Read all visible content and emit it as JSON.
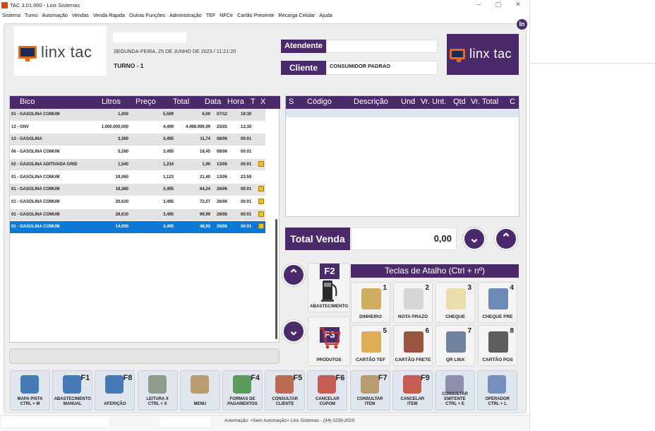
{
  "window": {
    "title": "TAC 3.01.000 - Linx Sistemas",
    "min": "─",
    "max": "▢",
    "close": "✕"
  },
  "menu": [
    "Sistema",
    "Turno",
    "Automação",
    "Vendas",
    "Venda Rapida",
    "Outras Funções",
    "Administração",
    "TEF",
    "NFCe",
    "Cartão Presente",
    "Recarga Celular",
    "Ajuda"
  ],
  "brand": {
    "logo_text": "linx tac",
    "badge": "In"
  },
  "header": {
    "datetime": "SEGUNDA-FEIRA, 25 DE JUNHO DE 2023 / 11:21:20",
    "turno": "TURNO - 1",
    "atendente_label": "Atendente",
    "atendente_value": "",
    "cliente_label": "Cliente",
    "cliente_value": "CONSUMIDOR PADRAO"
  },
  "abastecimentos": {
    "columns": [
      "Bico",
      "Litros",
      "Preço",
      "Total",
      "Data",
      "Hora",
      "T",
      "X"
    ],
    "rows": [
      {
        "bico": "01 - GASOLINA COMUM",
        "litros": "1,000",
        "preco": "5,599",
        "total": "6,00",
        "data": "07/12",
        "hora": "19:30",
        "t": false
      },
      {
        "bico": "13 - GNV",
        "litros": "1.000.000,000",
        "preco": "4,499",
        "total": "4.498.999,99",
        "data": "25/02",
        "hora": "13:35",
        "t": false
      },
      {
        "bico": "13 - GASOLINA",
        "litros": "3,360",
        "preco": "3,495",
        "total": "11,74",
        "data": "08/06",
        "hora": "00:01",
        "t": false
      },
      {
        "bico": "06 - GASOLINA COMUM",
        "litros": "5,280",
        "preco": "3,495",
        "total": "18,45",
        "data": "08/06",
        "hora": "00:01",
        "t": false
      },
      {
        "bico": "02 - GASOLINA ADITIVADA GRID",
        "litros": "1,540",
        "preco": "1,234",
        "total": "1,90",
        "data": "13/06",
        "hora": "00:01",
        "t": true
      },
      {
        "bico": "01 - GASOLINA COMUM",
        "litros": "19,060",
        "preco": "1,123",
        "total": "21,40",
        "data": "13/06",
        "hora": "23:59",
        "t": false
      },
      {
        "bico": "01 - GASOLINA COMUM",
        "litros": "18,380",
        "preco": "3,495",
        "total": "64,24",
        "data": "26/06",
        "hora": "00:01",
        "t": true
      },
      {
        "bico": "01 - GASOLINA COMUM",
        "litros": "20,620",
        "preco": "3,495",
        "total": "72,07",
        "data": "26/06",
        "hora": "00:01",
        "t": true
      },
      {
        "bico": "01 - GASOLINA COMUM",
        "litros": "28,610",
        "preco": "3,495",
        "total": "99,99",
        "data": "26/06",
        "hora": "00:01",
        "t": true
      },
      {
        "bico": "01 - GASOLINA COMUM",
        "litros": "14,000",
        "preco": "3,495",
        "total": "48,93",
        "data": "26/06",
        "hora": "00:01",
        "t": true
      }
    ]
  },
  "itens": {
    "columns": [
      "S",
      "Código",
      "Descrição",
      "Und",
      "Vr. Unt.",
      "Qtd",
      "Vr. Total",
      "C"
    ]
  },
  "total": {
    "label": "Total Venda",
    "value": "0,00"
  },
  "atalhos": {
    "title": "Teclas de Atalho (Ctrl + nº)",
    "keys": [
      {
        "num": "1",
        "label": "DINHEIRO"
      },
      {
        "num": "2",
        "label": "NOTA PRAZO"
      },
      {
        "num": "3",
        "label": "CHEQUE"
      },
      {
        "num": "4",
        "label": "CHEQUE PRE"
      },
      {
        "num": "5",
        "label": "CARTÃO TEF"
      },
      {
        "num": "6",
        "label": "CARTÃO FRETE"
      },
      {
        "num": "7",
        "label": "QR LINX"
      },
      {
        "num": "8",
        "label": "CARTÃO POS"
      }
    ]
  },
  "big_keys": {
    "abastecimento": {
      "fk": "F2",
      "label": "ABASTECIMENTO"
    },
    "produtos": {
      "fk": "F3",
      "label": "PRODUTOS"
    }
  },
  "bottom_buttons": [
    {
      "fk": "",
      "line1": "MAPA PISTA",
      "line2": "CTRL + M"
    },
    {
      "fk": "F1",
      "line1": "ABASTECIMENTO",
      "line2": "MANUAL"
    },
    {
      "fk": "F8",
      "line1": "AFERIÇÃO",
      "line2": ""
    },
    {
      "fk": "",
      "line1": "LEITURA X",
      "line2": "CTRL + X"
    },
    {
      "fk": "",
      "line1": "MENU",
      "line2": ""
    },
    {
      "fk": "F4",
      "line1": "FORMAS DE",
      "line2": "PAGAMENTOS"
    },
    {
      "fk": "F5",
      "line1": "CONSULTAR",
      "line2": "CLIENTE"
    },
    {
      "fk": "F6",
      "line1": "CANCELAR",
      "line2": "CUPOM"
    },
    {
      "fk": "F7",
      "line1": "CONSULTAR",
      "line2": "ITEM"
    },
    {
      "fk": "F9",
      "line1": "CANCELAR",
      "line2": "ITEM"
    },
    {
      "fk": "",
      "line1": "CONSULTAR",
      "line2": "EMITENTE",
      "line3": "CTRL + E"
    },
    {
      "fk": "",
      "line1": "OPERADOR",
      "line2": "CTRL + L"
    }
  ],
  "footer": {
    "status": "Automação: <Sem Automação>  Linx Sistemas - (34) 3239-2020"
  }
}
